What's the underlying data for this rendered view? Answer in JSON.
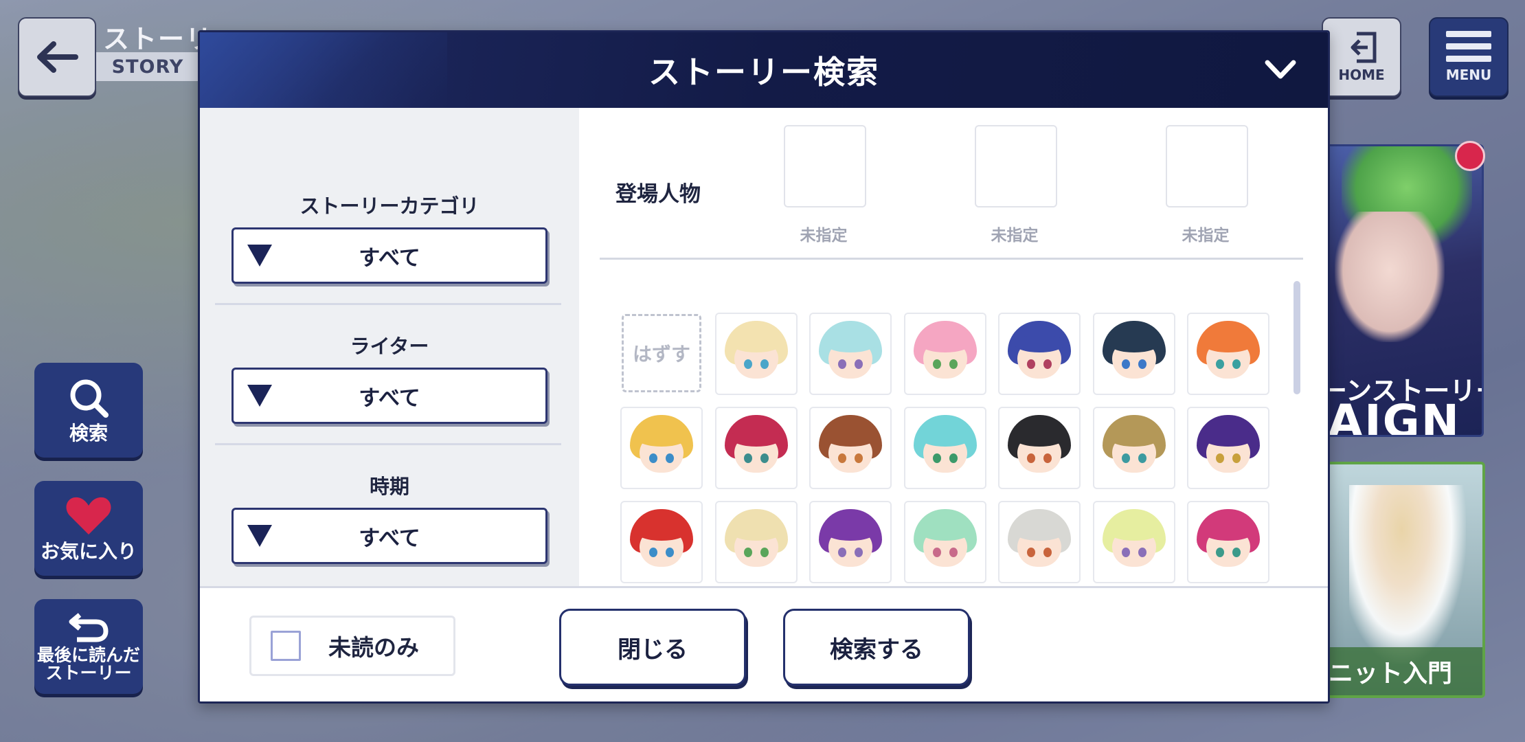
{
  "background": {
    "story_title": "ストーリ",
    "story_sub": "STORY",
    "home_label": "HOME",
    "menu_label": "MENU",
    "side_buttons": [
      "検索",
      "お気に入り",
      "最後に読んだ\nストーリー"
    ],
    "banner1": {
      "line1": "ーンストーリー",
      "line2": "AIGN"
    },
    "banner2": {
      "strip": "ニット入門"
    }
  },
  "modal": {
    "title": "ストーリー検索",
    "filters": [
      {
        "label": "ストーリーカテゴリ",
        "value": "すべて"
      },
      {
        "label": "ライター",
        "value": "すべて"
      },
      {
        "label": "時期",
        "value": "すべて"
      }
    ],
    "characters_label": "登場人物",
    "slots": [
      "未指定",
      "未指定",
      "未指定"
    ],
    "remove_label": "はずす",
    "character_grid": [
      {
        "hair": "#f3e2b0",
        "eye": "#4aa5c9"
      },
      {
        "hair": "#a9e0e4",
        "eye": "#8a6fb8"
      },
      {
        "hair": "#f5a6c2",
        "eye": "#5aa55a"
      },
      {
        "hair": "#3c4bab",
        "eye": "#b04060"
      },
      {
        "hair": "#263a52",
        "eye": "#3c78c8"
      },
      {
        "hair": "#f07a3a",
        "eye": "#3aa0a0"
      },
      {
        "hair": "#f0c24e",
        "eye": "#3c8dc8"
      },
      {
        "hair": "#c42c52",
        "eye": "#3c8d8d"
      },
      {
        "hair": "#9a5232",
        "eye": "#c8783c"
      },
      {
        "hair": "#72d4d8",
        "eye": "#3c9a6a"
      },
      {
        "hair": "#2a2a2e",
        "eye": "#c8643c"
      },
      {
        "hair": "#b49858",
        "eye": "#3c9aa0"
      },
      {
        "hair": "#4a2c8a",
        "eye": "#c8a03c"
      },
      {
        "hair": "#d8322e",
        "eye": "#3c8dc8"
      },
      {
        "hair": "#efe0b0",
        "eye": "#5aa55a"
      },
      {
        "hair": "#7a3aa8",
        "eye": "#8a6fb8"
      },
      {
        "hair": "#9fe0c0",
        "eye": "#c86a8a"
      },
      {
        "hair": "#d8d8d4",
        "eye": "#c8643c"
      },
      {
        "hair": "#e6eea0",
        "eye": "#8a6fb8"
      },
      {
        "hair": "#d23a7a",
        "eye": "#3c9a8a"
      },
      {
        "hair": "#3c4bab",
        "eye": "#4a6ac8"
      },
      {
        "hair": "#f0a898",
        "eye": "#4a8ac8"
      },
      {
        "hair": "#2c4a42",
        "eye": "#4a8ac8"
      },
      {
        "hair": "#e87838",
        "eye": "#4a8ac8"
      },
      {
        "hair": "#e86a30",
        "eye": "#4a8ac8"
      },
      {
        "hair": "#c02828",
        "eye": "#4a8ac8"
      },
      {
        "hair": "#6ab8e0",
        "eye": "#4a8ac8"
      }
    ],
    "unread_only_label": "未読のみ",
    "close_label": "閉じる",
    "search_label": "検索する"
  }
}
